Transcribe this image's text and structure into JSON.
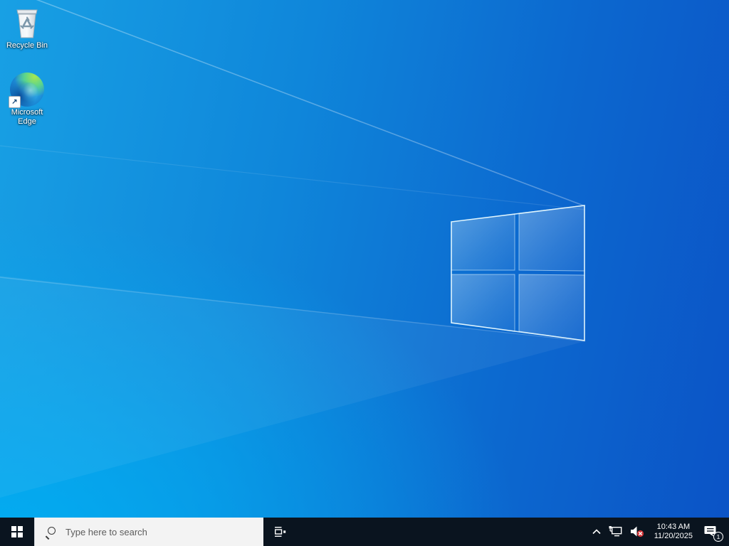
{
  "desktop": {
    "wallpaper": {
      "description": "Windows 10 default light-theme blue wallpaper with glass Windows logo",
      "base_left_color": "#18a0e4",
      "base_right_color": "#0b53c6",
      "glow_bottom_left_color": "#00adf2"
    },
    "icons": [
      {
        "id": "recycle-bin",
        "label": "Recycle Bin"
      },
      {
        "id": "microsoft-edge",
        "label": "Microsoft Edge",
        "shortcut_arrow": "↗"
      }
    ]
  },
  "taskbar": {
    "background_color": "#0a141f",
    "search": {
      "placeholder": "Type here to search"
    },
    "tray": {
      "clock": {
        "time": "10:43 AM",
        "date": "11/20/2025"
      },
      "volume_muted_badge_color": "#d13438",
      "notification_badge": "1"
    }
  }
}
